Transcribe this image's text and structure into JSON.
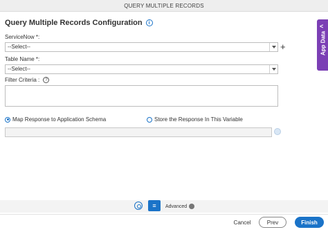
{
  "window": {
    "title": "QUERY MULTIPLE RECORDS"
  },
  "page": {
    "heading": "Query Multiple Records Configuration",
    "info_icon": "i"
  },
  "fields": {
    "servicenow": {
      "label": "ServiceNow *:",
      "value": "--Select--"
    },
    "table_name": {
      "label": "Table Name *:",
      "value": "--Select--"
    },
    "filter_criteria": {
      "label": "Filter Criteria :",
      "value": ""
    }
  },
  "response": {
    "option_map": "Map Response to Application Schema",
    "option_store": "Store the Response In This Variable",
    "selected": "option_map"
  },
  "app_data": {
    "label": "App Data",
    "chevron": "<"
  },
  "toolbar": {
    "advanced_label": "Advanced"
  },
  "buttons": {
    "cancel": "Cancel",
    "prev": "Prev",
    "finish": "Finish"
  },
  "colors": {
    "accent": "#1a73c8",
    "app_data_tab": "#7b3fb5"
  }
}
